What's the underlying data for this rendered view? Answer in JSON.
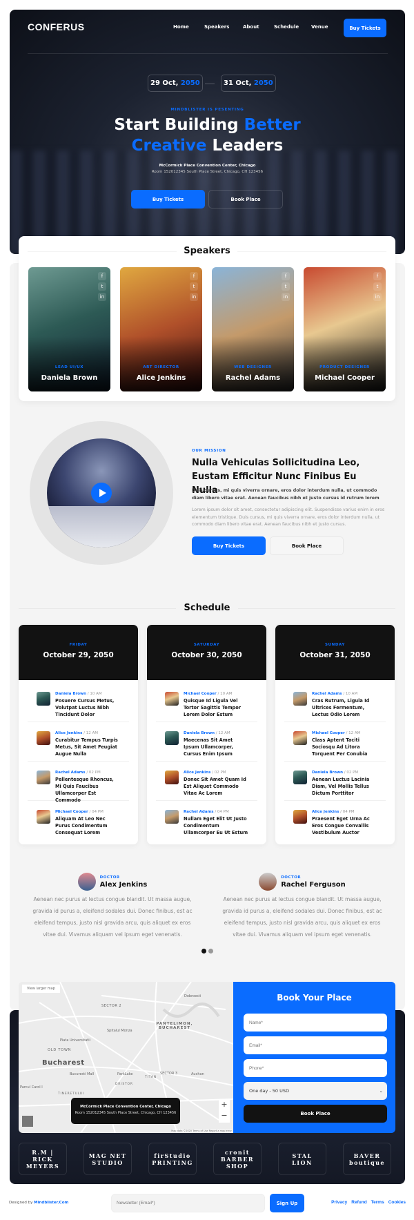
{
  "brand": {
    "logo": "CONFERUS",
    "accent": "#0a6cff",
    "dark": "#121212"
  },
  "nav": {
    "items": [
      "Home",
      "Speakers",
      "About",
      "Schedule",
      "Venue"
    ],
    "cta": "Buy Tickets"
  },
  "hero": {
    "date_start": {
      "day": "29 Oct,",
      "year": "2050"
    },
    "date_end": {
      "day": "31 Oct,",
      "year": "2050"
    },
    "eyebrow": "MINDBLISTER IS PESENTING",
    "title_a": "Start Building ",
    "title_b": "Better",
    "title_c": "Creative",
    "title_d": " Leaders",
    "venue": "McCormick Place Convention Center, Chicago",
    "address": "Room 152012345 South Place Street, Chicago, CH 123456",
    "buy": "Buy Tickets",
    "book": "Book Place"
  },
  "speakers": {
    "title": "Speakers",
    "items": [
      {
        "role": "LEAD UI/UX",
        "name": "Daniela Brown"
      },
      {
        "role": "ART DIRECTOR",
        "name": "Alice Jenkins"
      },
      {
        "role": "WEB DESIGNER",
        "name": "Rachel Adams"
      },
      {
        "role": "PRODUCT DESIGNER",
        "name": "Michael Cooper"
      }
    ],
    "social": [
      "f",
      "t",
      "in"
    ]
  },
  "mission": {
    "eyebrow": "OUR MISSION",
    "title": "Nulla Vehiculas Sollicitudina Leo, Eustam Efficitur Nunc Finibus Eu Nulla",
    "lead": "Duis cursus, mi quis viverra ornare, eros dolor interdum nulla, ut commodo diam libero vitae erat. Aenean faucibus nibh et justo cursus id rutrum lorem",
    "body": "Lorem ipsum dolor sit amet, consectetur adipiscing elit. Suspendisse varius enim in eros elementum tristique. Duis cursus, mi quis viverra ornare, eros dolor interdum nulla, ut commodo diam libero vitae erat. Aenean faucibus nibh et justo cursus.",
    "buy": "Buy Tickets",
    "book": "Book Place"
  },
  "schedule": {
    "title": "Schedule",
    "days": [
      {
        "day": "FRIDAY",
        "date": "October 29, 2050",
        "items": [
          {
            "who": "Daniela Brown",
            "time": "/ 10 AM",
            "title": "Posuere Cursus Metus, Volutpat Luctus Nibh Tincidunt Dolor"
          },
          {
            "who": "Alice Jenkins",
            "time": "/ 12 AM",
            "title": "Curabitur Tempus Turpis Metus, Sit Amet Feugiat Augue Nulla"
          },
          {
            "who": "Rachel Adams",
            "time": "/ 02 PM",
            "title": "Pellentesque Rhoncus, Mi Quis Faucibus Ullamcorper Est Commodo"
          },
          {
            "who": "Michael Cooper",
            "time": "/ 04 PM",
            "title": "Aliquam At Leo Nec Purus Condimentum Consequat Lorem"
          }
        ]
      },
      {
        "day": "SATURDAY",
        "date": "October 30, 2050",
        "items": [
          {
            "who": "Michael Cooper",
            "time": "/ 10 AM",
            "title": "Quisque Id Ligula Vel Tortor Sagittis Tempor Lorem Dolor Estum"
          },
          {
            "who": "Daniela Brown",
            "time": "/ 12 AM",
            "title": "Maecenas Sit Amet Ipsum Ullamcorper, Cursus Enim Ipsum"
          },
          {
            "who": "Alice Jenkins",
            "time": "/ 02 PM",
            "title": "Donec Sit Amet Quam Id Est Aliquet Commodo Vitae Ac Lorem"
          },
          {
            "who": "Rachel Adams",
            "time": "/ 04 PM",
            "title": "Nullam Eget Elit Ut Justo Condimentum Ullamcorper Eu Ut Estum"
          }
        ]
      },
      {
        "day": "SUNDAY",
        "date": "October 31, 2050",
        "items": [
          {
            "who": "Rachel Adams",
            "time": "/ 10 AM",
            "title": "Cras Rutrum, Ligula Id Ultrices Fermentum, Lectus Odio Lorem"
          },
          {
            "who": "Michael Cooper",
            "time": "/ 12 AM",
            "title": "Class Aptent Taciti Sociosqu Ad Litora Torquent Per Conubia"
          },
          {
            "who": "Daniela Brown",
            "time": "/ 02 PM",
            "title": "Aenean Luctus Lacinia Diam, Vel Mollis Tellus Dictum Porttitor"
          },
          {
            "who": "Alice Jenkins",
            "time": "/ 04 PM",
            "title": "Praesent Eget Urna Ac Eros Congue Convallis Vestibulum Auctor"
          }
        ]
      }
    ]
  },
  "testimonials": {
    "items": [
      {
        "role": "DOCTOR",
        "name": "Alex Jenkins",
        "text": "Aenean nec purus at lectus congue blandit. Ut massa augue, gravida id purus a, eleifend sodales dui. Donec finibus, est ac eleifend tempus, justo nisl gravida arcu, quis aliquet ex eros vitae dui. Vivamus aliquam vel ipsum eget venenatis."
      },
      {
        "role": "DOCTOR",
        "name": "Rachel Ferguson",
        "text": "Aenean nec purus at lectus congue blandit. Ut massa augue, gravida id purus a, eleifend sodales dui. Donec finibus, est ac eleifend tempus, justo nisl gravida arcu, quis aliquet ex eros vitae dui. Vivamus aliquam vel ipsum eget venenatis."
      }
    ],
    "active_slide": 1,
    "slides": 2
  },
  "map": {
    "view_larger": "View larger map",
    "labels": [
      "Bucharest",
      "PANTELIMON, BUCHAREST",
      "SECTOR 2",
      "SECTOR 3",
      "OLD TOWN",
      "Piata Universitatii",
      "Spitalul Monza",
      "ParkLake",
      "Bucuresti Mall",
      "Parcul Carol I",
      "TINERETULUI",
      "DRISTOR",
      "TITAN",
      "Auchan",
      "Dobroesti"
    ],
    "venue": "McCormick Place Convention Center, Chicago",
    "address": "Room 152012345 South Place Street, Chicago, CH 123456",
    "zoom_in": "+",
    "zoom_out": "−",
    "attribution": "Map data ©2020   Terms of Use   Report a map error"
  },
  "booking": {
    "title": "Book Your Place",
    "name_ph": "Name*",
    "email_ph": "Email*",
    "phone_ph": "Phone*",
    "option": "One day - 50 USD",
    "submit": "Book Place"
  },
  "partners": [
    "R.M | RICK MEYERS",
    "MAG NET STUDIO",
    "firStudio PRINTING",
    "cronit BARBER SHOP",
    "STAL LION",
    "BAVER boutique"
  ],
  "footer": {
    "designed_by": "Designed by ",
    "designer": "Mindblister.Com",
    "newsletter_ph": "Newsletter (Email*)",
    "signup": "Sign Up",
    "links": [
      "Privacy",
      "Refund",
      "Terms",
      "Cookies"
    ]
  }
}
